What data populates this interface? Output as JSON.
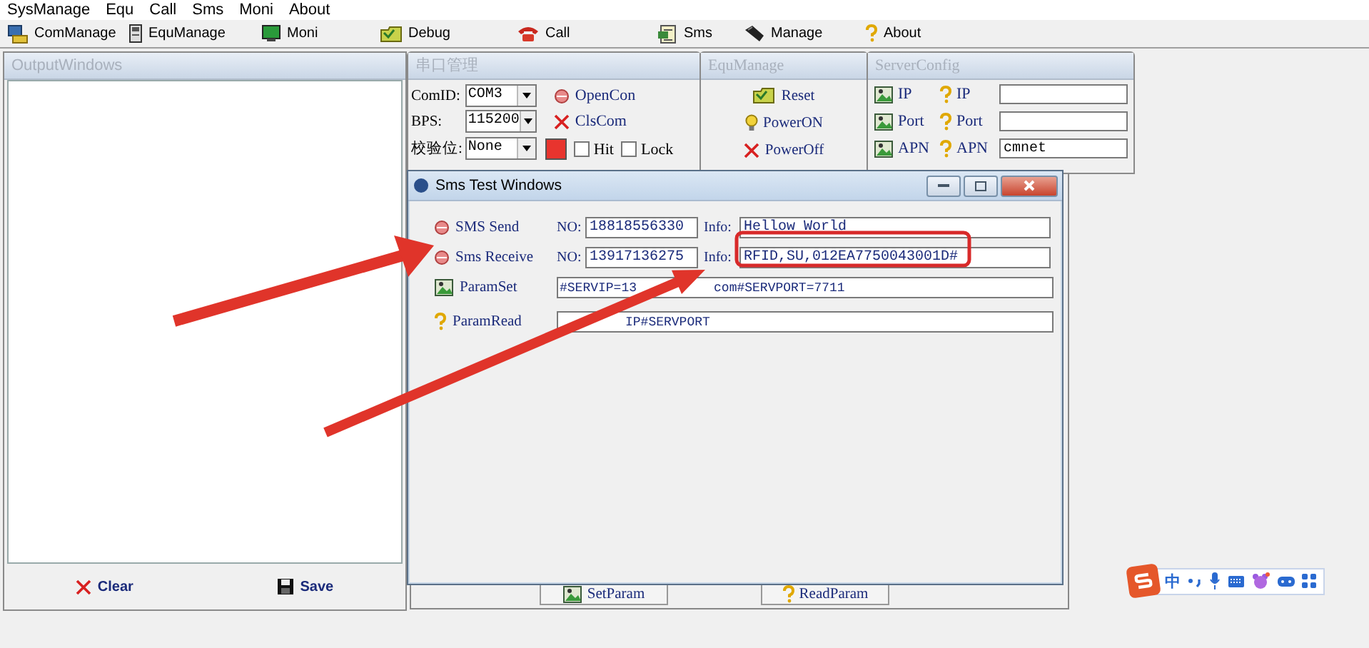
{
  "menu": [
    "SysManage",
    "Equ",
    "Call",
    "Sms",
    "Moni",
    "About"
  ],
  "toolbar": [
    "ComManage",
    "EquManage",
    "Moni",
    "Debug",
    "Call",
    "Sms",
    "Manage",
    "About"
  ],
  "output_window": {
    "title": "OutputWindows",
    "buttons": [
      "Clear",
      "Save"
    ]
  },
  "com_port": {
    "title": "串口管理",
    "fields": [
      {
        "label": "ComID:",
        "value": "COM3"
      },
      {
        "label": "BPS:",
        "value": "115200"
      },
      {
        "label": "校验位:",
        "value": "None"
      }
    ],
    "buttons": [
      "OpenCon",
      "ClsCom"
    ],
    "indicator": {
      "color": "#e8342e"
    },
    "checkboxes": [
      {
        "label": "Hit",
        "checked": false
      },
      {
        "label": "Lock",
        "checked": false
      }
    ]
  },
  "equ_manage": {
    "title": "EquManage",
    "buttons": [
      "Reset",
      "PowerON",
      "PowerOff"
    ]
  },
  "server_config": {
    "title": "ServerConfig",
    "rows": [
      {
        "set": "IP",
        "read": "IP"
      },
      {
        "set": "Port",
        "read": "Port"
      },
      {
        "set": "APN",
        "read": "APN",
        "value": "cmnet"
      }
    ]
  },
  "param_panel": {
    "buttons": [
      "SetParam",
      "ReadParam"
    ]
  },
  "sms_window": {
    "title": "Sms Test Windows",
    "messages": [
      {
        "button": "SMS Send",
        "no_label": "NO:",
        "number": "18818556330",
        "info_label": "Info:",
        "info": "Hellow World"
      },
      {
        "button": "Sms Receive",
        "no_label": "NO:",
        "number": "13917136275",
        "info_label": "Info:",
        "info": "RFID,SU,012EA7750043001D#"
      }
    ],
    "params": [
      {
        "button": "ParamSet",
        "value_parts": [
          "#SERVIP=13",
          "com#SERVPORT=7711"
        ]
      },
      {
        "button": "ParamRead",
        "value_parts": [
          "IP#SERVPORT"
        ]
      }
    ]
  },
  "ime_bar": {
    "mode": "中"
  }
}
